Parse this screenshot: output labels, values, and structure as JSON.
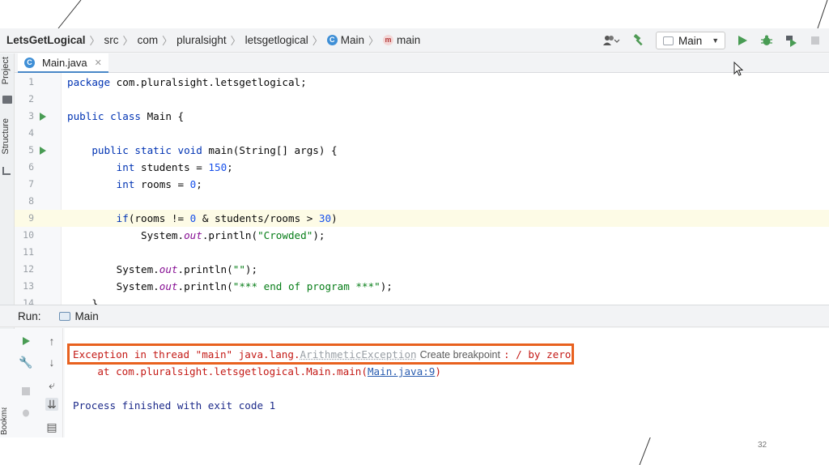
{
  "navbar": {
    "crumbs": [
      "LetsGetLogical",
      "src",
      "com",
      "pluralsight",
      "letsgetlogical",
      "Main",
      "main"
    ],
    "run_config": "Main"
  },
  "left_strip": {
    "project": "Project",
    "structure": "Structure",
    "bookmarks": "Bookmarks"
  },
  "editor": {
    "tab": "Main.java",
    "lines": [
      {
        "n": "1"
      },
      {
        "n": "2"
      },
      {
        "n": "3"
      },
      {
        "n": "4"
      },
      {
        "n": "5"
      },
      {
        "n": "6"
      },
      {
        "n": "7"
      },
      {
        "n": "8"
      },
      {
        "n": "9"
      },
      {
        "n": "10"
      },
      {
        "n": "11"
      },
      {
        "n": "12"
      },
      {
        "n": "13"
      },
      {
        "n": "14"
      }
    ]
  },
  "run_panel": {
    "label": "Run:",
    "tab": "Main",
    "console": {
      "line1": {
        "prefix": "Exception in thread \"main\" java.lang.",
        "exception": "ArithmeticException",
        "breakpoint": "Create breakpoint",
        "suffix": ": / by zero"
      },
      "line2": {
        "prefix": "    at com.pluralsight.letsgetlogical.Main.main(",
        "link": "Main.java:9",
        "suffix": ")"
      },
      "line3": "Process finished with exit code 1"
    }
  },
  "slide": {
    "page_number": "32"
  },
  "colors": {
    "highlight_box": "#e8611f",
    "run_green": "#499c54"
  }
}
